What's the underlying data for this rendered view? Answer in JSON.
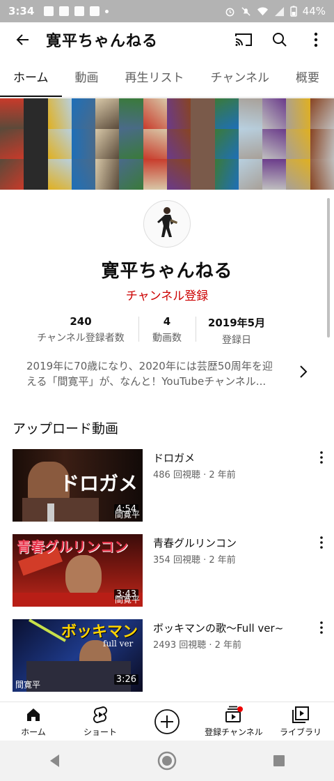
{
  "status_bar": {
    "time": "3:34",
    "battery": "44%"
  },
  "app_bar": {
    "title": "寛平ちゃんねる"
  },
  "tabs": [
    {
      "label": "ホーム",
      "active": true
    },
    {
      "label": "動画",
      "active": false
    },
    {
      "label": "再生リスト",
      "active": false
    },
    {
      "label": "チャンネル",
      "active": false
    },
    {
      "label": "概要",
      "active": false
    }
  ],
  "channel": {
    "name": "寛平ちゃんねる",
    "subscribe_label": "チャンネル登録",
    "stats": [
      {
        "value": "240",
        "label": "チャンネル登録者数"
      },
      {
        "value": "4",
        "label": "動画数"
      },
      {
        "value": "2019年5月",
        "label": "登録日"
      }
    ],
    "description_line1": "2019年に70歳になり、2020年には芸歴50周年を迎",
    "description_line2": "える「間寛平」が、なんと！YouTubeチャンネル..."
  },
  "uploads": {
    "section_title": "アップロード動画",
    "videos": [
      {
        "title": "ドロガメ",
        "meta": "486 回視聴 · 2 年前",
        "duration": "4:54",
        "thumb_text": "ドロガメ",
        "watermark": "間寛平"
      },
      {
        "title": "青春グルリンコン",
        "meta": "354 回視聴 · 2 年前",
        "duration": "3:43",
        "thumb_text": "青春グルリンコン",
        "watermark": "間寛平"
      },
      {
        "title": "ボッキマンの歌〜Full ver~",
        "meta": "2493 回視聴 · 2 年前",
        "duration": "3:26",
        "thumb_text": "ボッキマン",
        "thumb_sub": "full ver",
        "watermark": "間寛平"
      }
    ]
  },
  "bottom_nav": [
    {
      "label": "ホーム",
      "icon": "home-icon"
    },
    {
      "label": "ショート",
      "icon": "shorts-icon"
    },
    {
      "label": "",
      "icon": "create-plus-icon"
    },
    {
      "label": "登録チャンネル",
      "icon": "subscriptions-icon"
    },
    {
      "label": "ライブラリ",
      "icon": "library-icon"
    }
  ],
  "colors": {
    "accent_red": "#cc0000",
    "text_primary": "#0f0f0f",
    "text_secondary": "#606060"
  }
}
